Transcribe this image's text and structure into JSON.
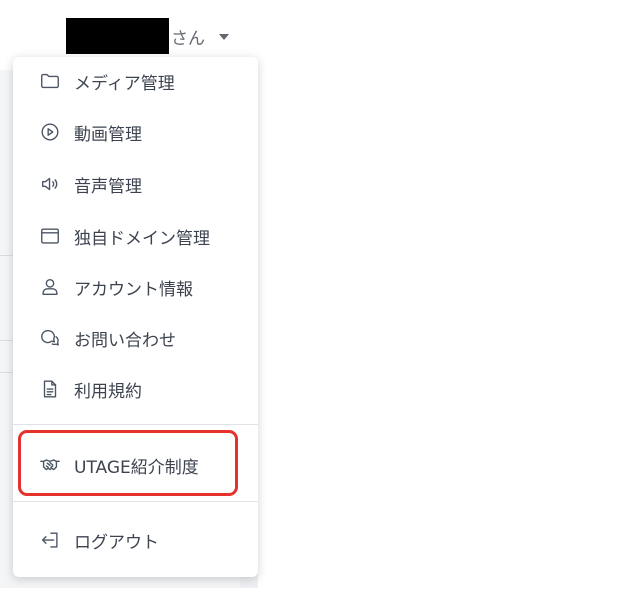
{
  "header": {
    "user_suffix": "さん",
    "caret_icon": "caret-down-icon"
  },
  "menu": {
    "items": [
      {
        "label": "メディア管理",
        "icon": "folder-icon"
      },
      {
        "label": "動画管理",
        "icon": "play-circle-icon"
      },
      {
        "label": "音声管理",
        "icon": "speaker-icon"
      },
      {
        "label": "独自ドメイン管理",
        "icon": "browser-window-icon"
      },
      {
        "label": "アカウント情報",
        "icon": "user-icon"
      },
      {
        "label": "お問い合わせ",
        "icon": "chat-bubbles-icon"
      },
      {
        "label": "利用規約",
        "icon": "document-icon"
      }
    ],
    "referral": {
      "label": "UTAGE紹介制度",
      "icon": "handshake-icon"
    },
    "logout": {
      "label": "ログアウト",
      "icon": "logout-icon"
    }
  },
  "colors": {
    "highlight": "#e5322d",
    "text": "#3d4450",
    "icon": "#4b5563"
  }
}
